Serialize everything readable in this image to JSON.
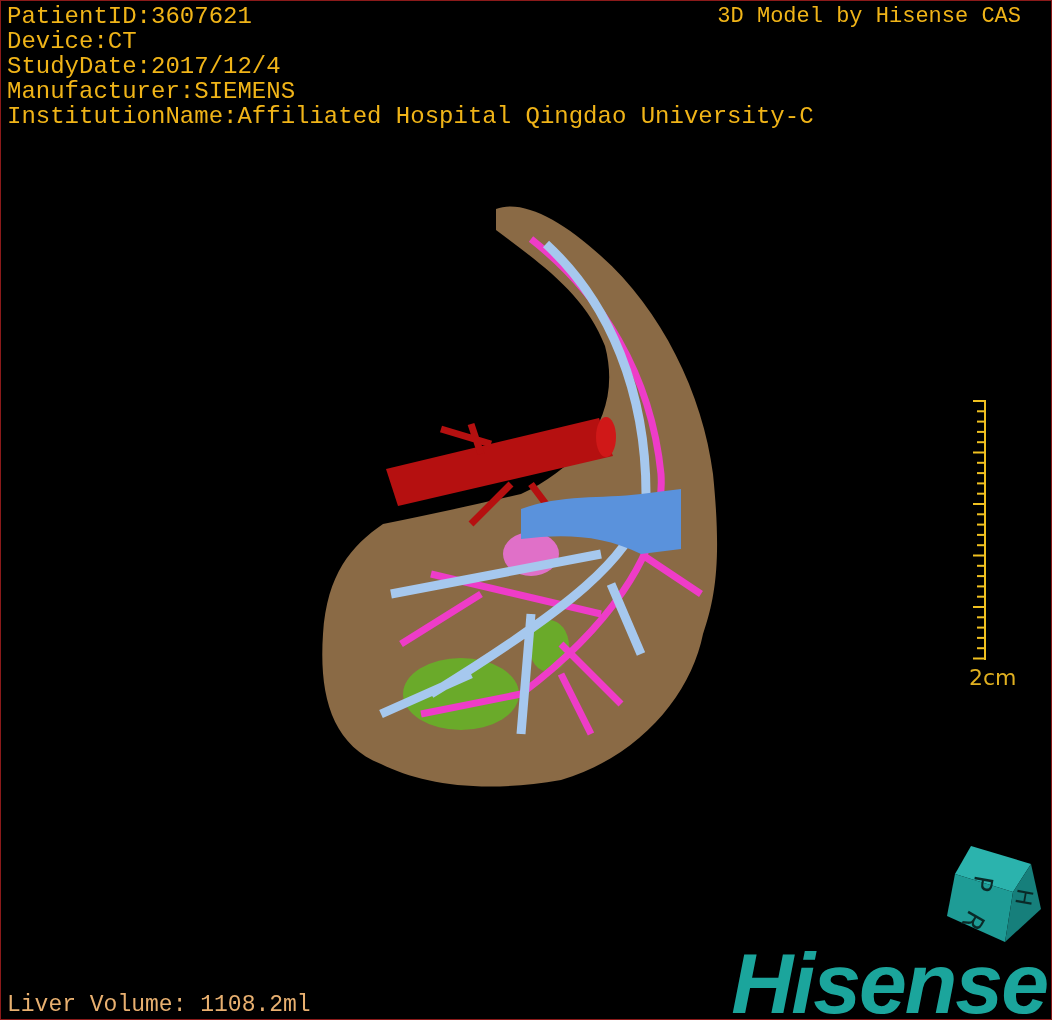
{
  "header": {
    "info_lines": [
      "PatientID:3607621",
      "Device:CT",
      "StudyDate:2017/12/4",
      "Manufacturer:SIEMENS",
      "InstitutionName:Affiliated Hospital Qingdao University-C"
    ],
    "title": "3D Model by Hisense CAS"
  },
  "scale_bar": {
    "label": "2cm"
  },
  "orientation_cube": {
    "faces": [
      "P",
      "H",
      "R"
    ]
  },
  "footer": {
    "liver_volume": "Liver Volume: 1108.2ml",
    "logo": "Hisense"
  }
}
